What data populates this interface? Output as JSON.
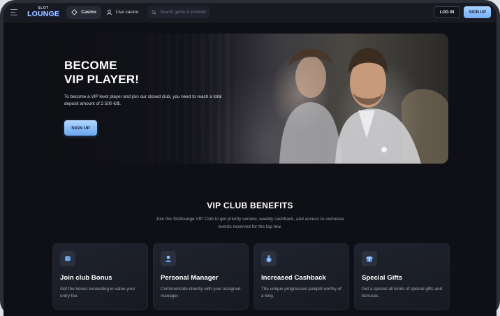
{
  "header": {
    "logo_top": "SLOT",
    "logo_main": "LOUNGE",
    "nav": [
      {
        "label": "Casino",
        "icon": "casino-icon",
        "active": true
      },
      {
        "label": "Live casino",
        "icon": "live-casino-icon",
        "active": false
      }
    ],
    "search_placeholder": "Search game or provider",
    "login_label": "LOG IN",
    "signup_label": "SIGN UP"
  },
  "hero": {
    "title_line1": "BECOME",
    "title_line2": "VIP PLAYER!",
    "description": "To become a VIP level player and join our closed club, you need to reach a total deposit amount of 2 500 €/$.",
    "button_label": "SIGN UP"
  },
  "benefits": {
    "title": "VIP CLUB BENEFITS",
    "subtitle": "Join the Slotlounge VIP Club to get priority service, weekly cashback, and access to exclusive events reserved for the top few.",
    "cards": [
      {
        "icon": "coins-icon",
        "title": "Join club Bonus",
        "description": "Get the bonus exceeding in value your entry fee."
      },
      {
        "icon": "manager-icon",
        "title": "Personal Manager",
        "description": "Communicate directly with your assigned manager."
      },
      {
        "icon": "money-bag-icon",
        "title": "Increased Cashback",
        "description": "The unique progressive jackpot worthy of a king."
      },
      {
        "icon": "gift-icon",
        "title": "Special Gifts",
        "description": "Get a special all kinds of special gifts and bonuses."
      }
    ]
  },
  "colors": {
    "background": "#0f1015",
    "header": "#181a22",
    "accent": "#7fb6f7",
    "card": "#1c2029"
  }
}
